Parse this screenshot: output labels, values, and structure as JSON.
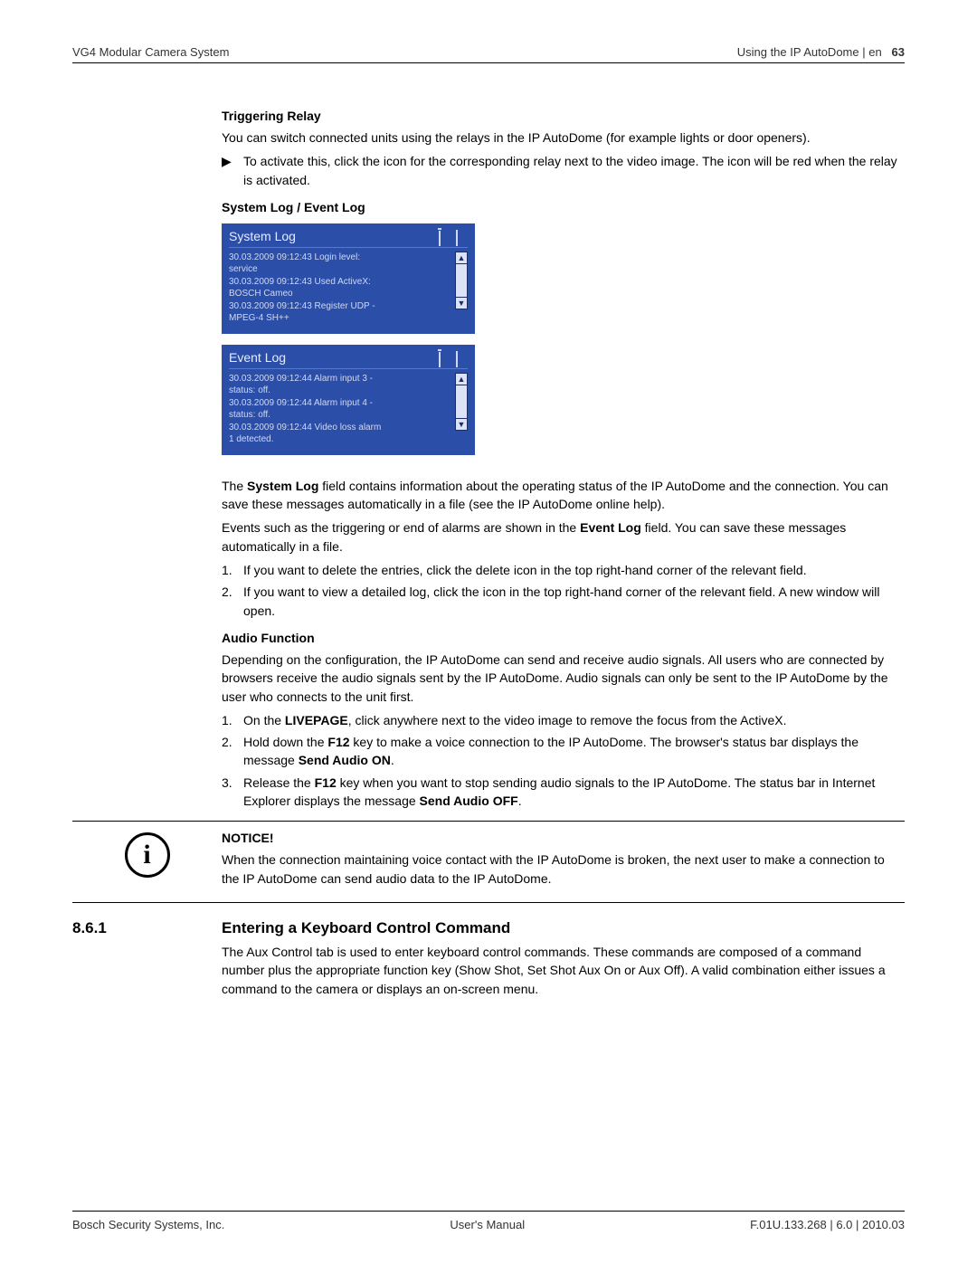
{
  "header": {
    "left": "VG4 Modular Camera System",
    "right_text": "Using the IP AutoDome | en",
    "page_number": "63"
  },
  "triggering_relay": {
    "title": "Triggering Relay",
    "p1": "You can switch connected units using the relays in the IP AutoDome (for example lights or door openers).",
    "bullet": "To activate this, click the icon for the corresponding relay next to the video image. The icon will be red when the relay is activated."
  },
  "system_event_log": {
    "title": "System Log / Event Log",
    "system_log": {
      "title": "System Log",
      "lines": "30.03.2009 09:12:43 Login level:\nservice\n30.03.2009 09:12:43 Used ActiveX:\nBOSCH Cameo\n30.03.2009 09:12:43 Register UDP -\nMPEG-4 SH++"
    },
    "event_log": {
      "title": "Event Log",
      "lines": "30.03.2009 09:12:44 Alarm input 3 -\nstatus: off.\n30.03.2009 09:12:44 Alarm input 4 -\nstatus: off.\n30.03.2009 09:12:44 Video loss alarm\n1 detected."
    },
    "desc_p1_a": "The ",
    "desc_p1_b": "System Log",
    "desc_p1_c": " field contains information about the operating status of the IP AutoDome and the connection. You can save these messages automatically in a file (see the IP AutoDome online help).",
    "desc_p2_a": "Events such as the triggering or end of alarms are shown in the ",
    "desc_p2_b": "Event Log",
    "desc_p2_c": " field. You can save these messages automatically in a file.",
    "li1": "If you want to delete the entries, click the delete icon in the top right-hand corner of the relevant field.",
    "li2": "If you want to view a detailed log, click the icon in the top right-hand corner of the relevant field. A new window will open."
  },
  "audio_function": {
    "title": "Audio Function",
    "p1": "Depending on the configuration, the IP AutoDome can send and receive audio signals. All users who are connected by browsers receive the audio signals sent by the IP AutoDome. Audio signals can only be sent to the IP AutoDome by the user who connects to the unit first.",
    "li1_a": "On the ",
    "li1_b": "LIVEPAGE",
    "li1_c": ", click anywhere next to the video image to remove the focus from the ActiveX.",
    "li2_a": "Hold down the ",
    "li2_b": "F12",
    "li2_c": " key to make a voice connection to the IP AutoDome. The browser's status bar displays the message ",
    "li2_d": "Send Audio ON",
    "li2_e": ".",
    "li3_a": "Release the ",
    "li3_b": "F12",
    "li3_c": " key when you want to stop sending audio signals to the IP AutoDome. The status bar in Internet Explorer displays the message ",
    "li3_d": "Send Audio OFF",
    "li3_e": "."
  },
  "notice": {
    "title": "NOTICE!",
    "body": "When the connection maintaining voice contact with the IP AutoDome is broken, the next user to make a connection to the IP AutoDome can send audio data to the IP AutoDome.",
    "icon_glyph": "i"
  },
  "subsection": {
    "number": "8.6.1",
    "title": "Entering a Keyboard Control Command",
    "p1": "The Aux Control tab is used to enter keyboard control commands. These commands are composed of a command number plus the appropriate function key (Show Shot, Set Shot Aux On or Aux Off). A valid combination either issues a command to the camera or displays an on-screen menu."
  },
  "footer": {
    "left": "Bosch Security Systems, Inc.",
    "center": "User's Manual",
    "right": "F.01U.133.268 | 6.0 | 2010.03"
  },
  "symbols": {
    "arrow": "▶",
    "up": "▲",
    "down": "▼"
  }
}
